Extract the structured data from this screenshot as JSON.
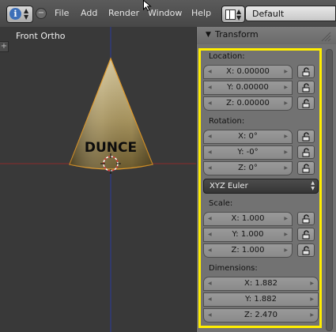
{
  "menu": {
    "info_icon": "i",
    "items": [
      "File",
      "Add",
      "Render",
      "Window",
      "Help"
    ],
    "screen_layout": "Default"
  },
  "viewport": {
    "label": "Front Ortho",
    "object_text": "DUNCE",
    "colors": {
      "cone_top": "#cdbe96",
      "cone_bottom": "#6f5e31",
      "outline": "#e19a2a",
      "z_axis": "#2a3a9a",
      "x_axis": "#8a2a2a"
    }
  },
  "panel": {
    "title": "Transform",
    "highlight_color": "#ffee00",
    "location": {
      "label": "Location:",
      "x": "X: 0.00000",
      "y": "Y: 0.00000",
      "z": "Z: 0.00000"
    },
    "rotation": {
      "label": "Rotation:",
      "x": "X: 0°",
      "y": "Y: -0°",
      "z": "Z: 0°",
      "mode": "XYZ Euler"
    },
    "scale": {
      "label": "Scale:",
      "x": "X: 1.000",
      "y": "Y: 1.000",
      "z": "Z: 1.000"
    },
    "dimensions": {
      "label": "Dimensions:",
      "x": "X: 1.882",
      "y": "Y: 1.882",
      "z": "Z: 2.470"
    }
  }
}
